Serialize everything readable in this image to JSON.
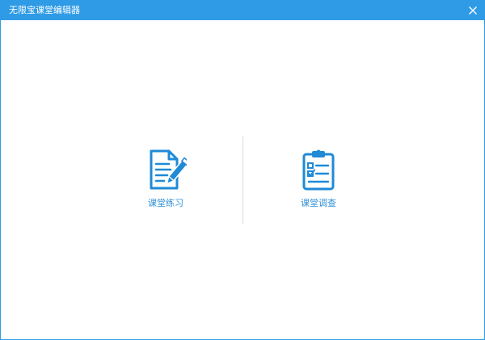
{
  "window": {
    "title": "无限宝课堂编辑器",
    "accent_color": "#2f9be6",
    "close_icon": "close-icon"
  },
  "options": [
    {
      "label": "课堂练习",
      "icon": "document-pencil-icon",
      "color": "#1f8ad6"
    },
    {
      "label": "课堂调查",
      "icon": "clipboard-checklist-icon",
      "color": "#1f8ad6"
    }
  ]
}
